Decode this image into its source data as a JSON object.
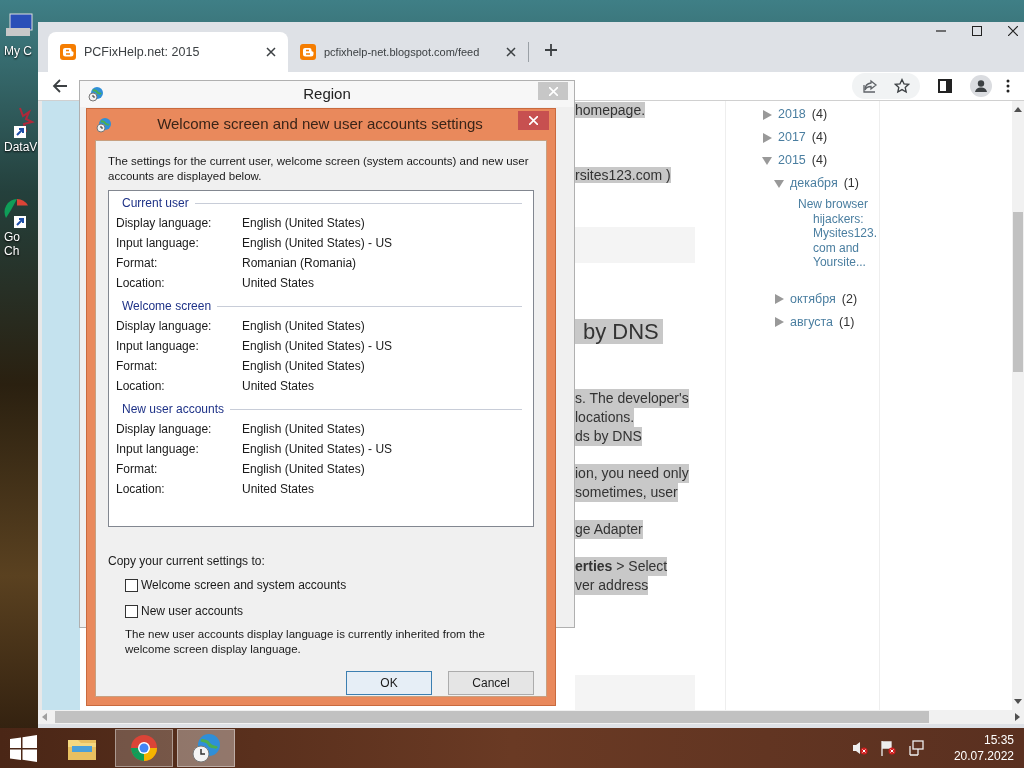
{
  "desktop": {
    "icons": [
      {
        "kind": "computer",
        "label": "My C"
      },
      {
        "kind": "chart",
        "label": "DataV"
      },
      {
        "kind": "chrome",
        "label": "Go Ch"
      }
    ]
  },
  "browser": {
    "tabs": [
      {
        "title": "PCFixHelp.net: 2015",
        "selected": true
      },
      {
        "title": "pcfixhelp-net.blogspot.com/feed",
        "selected": false
      }
    ],
    "fragments": [
      {
        "kind": "line",
        "text": "homepage."
      },
      {
        "kind": "line",
        "text": "rsites123.com )"
      },
      {
        "kind": "panel"
      },
      {
        "kind": "heading",
        "text": "by DNS"
      },
      {
        "kind": "para",
        "lines": [
          "s. The developer's",
          "locations.",
          "ds by DNS"
        ]
      },
      {
        "kind": "para",
        "lines": [
          "ion, you need only",
          "sometimes, user"
        ]
      },
      {
        "kind": "para",
        "lines": [
          "ge Adapter"
        ]
      },
      {
        "kind": "para",
        "lines": [
          "**erties** > Select",
          "ver address"
        ]
      },
      {
        "kind": "panel"
      }
    ],
    "archive": [
      {
        "kind": "period",
        "label": "2018",
        "count": "(4)",
        "expanded": false
      },
      {
        "kind": "period",
        "label": "2017",
        "count": "(4)",
        "expanded": false
      },
      {
        "kind": "period",
        "label": "2015",
        "count": "(4)",
        "expanded": true,
        "children": [
          {
            "kind": "period",
            "label": "декабря",
            "count": "(1)",
            "expanded": true,
            "children": [
              {
                "kind": "post",
                "label": "New browser hijackers: Mysites123. com and Yoursite..."
              }
            ]
          },
          {
            "kind": "period",
            "label": "октября",
            "count": "(2)",
            "expanded": false
          },
          {
            "kind": "period",
            "label": "августа",
            "count": "(1)",
            "expanded": false
          }
        ]
      }
    ]
  },
  "region_window": {
    "title": "Region"
  },
  "dialog": {
    "title": "Welcome screen and new user accounts settings",
    "intro": "The settings for the current user, welcome screen (system accounts) and new user accounts are displayed below.",
    "groups": [
      {
        "title": "Current user",
        "rows": [
          {
            "label": "Display language:",
            "value": "English (United States)"
          },
          {
            "label": "Input language:",
            "value": "English (United States) - US"
          },
          {
            "label": "Format:",
            "value": "Romanian (Romania)"
          },
          {
            "label": "Location:",
            "value": "United States"
          }
        ]
      },
      {
        "title": "Welcome screen",
        "rows": [
          {
            "label": "Display language:",
            "value": "English (United States)"
          },
          {
            "label": "Input language:",
            "value": "English (United States) - US"
          },
          {
            "label": "Format:",
            "value": "English (United States)"
          },
          {
            "label": "Location:",
            "value": "United States"
          }
        ]
      },
      {
        "title": "New user accounts",
        "rows": [
          {
            "label": "Display language:",
            "value": "English (United States)"
          },
          {
            "label": "Input language:",
            "value": "English (United States) - US"
          },
          {
            "label": "Format:",
            "value": "English (United States)"
          },
          {
            "label": "Location:",
            "value": "United States"
          }
        ]
      }
    ],
    "copy_label": "Copy your current settings to:",
    "checkboxes": [
      {
        "label": "Welcome screen and system accounts",
        "checked": false
      },
      {
        "label": "New user accounts",
        "checked": false
      }
    ],
    "note": "The new user accounts display language is currently inherited from the welcome screen display language.",
    "buttons": [
      {
        "label": "OK",
        "default": true
      },
      {
        "label": "Cancel",
        "default": false
      }
    ]
  },
  "taskbar": {
    "apps": [
      {
        "kind": "explorer",
        "running": false,
        "selected": false
      },
      {
        "kind": "chrome",
        "running": true,
        "selected": false
      },
      {
        "kind": "region",
        "running": true,
        "selected": true
      }
    ],
    "time": "15:35",
    "date": "20.07.2022"
  }
}
